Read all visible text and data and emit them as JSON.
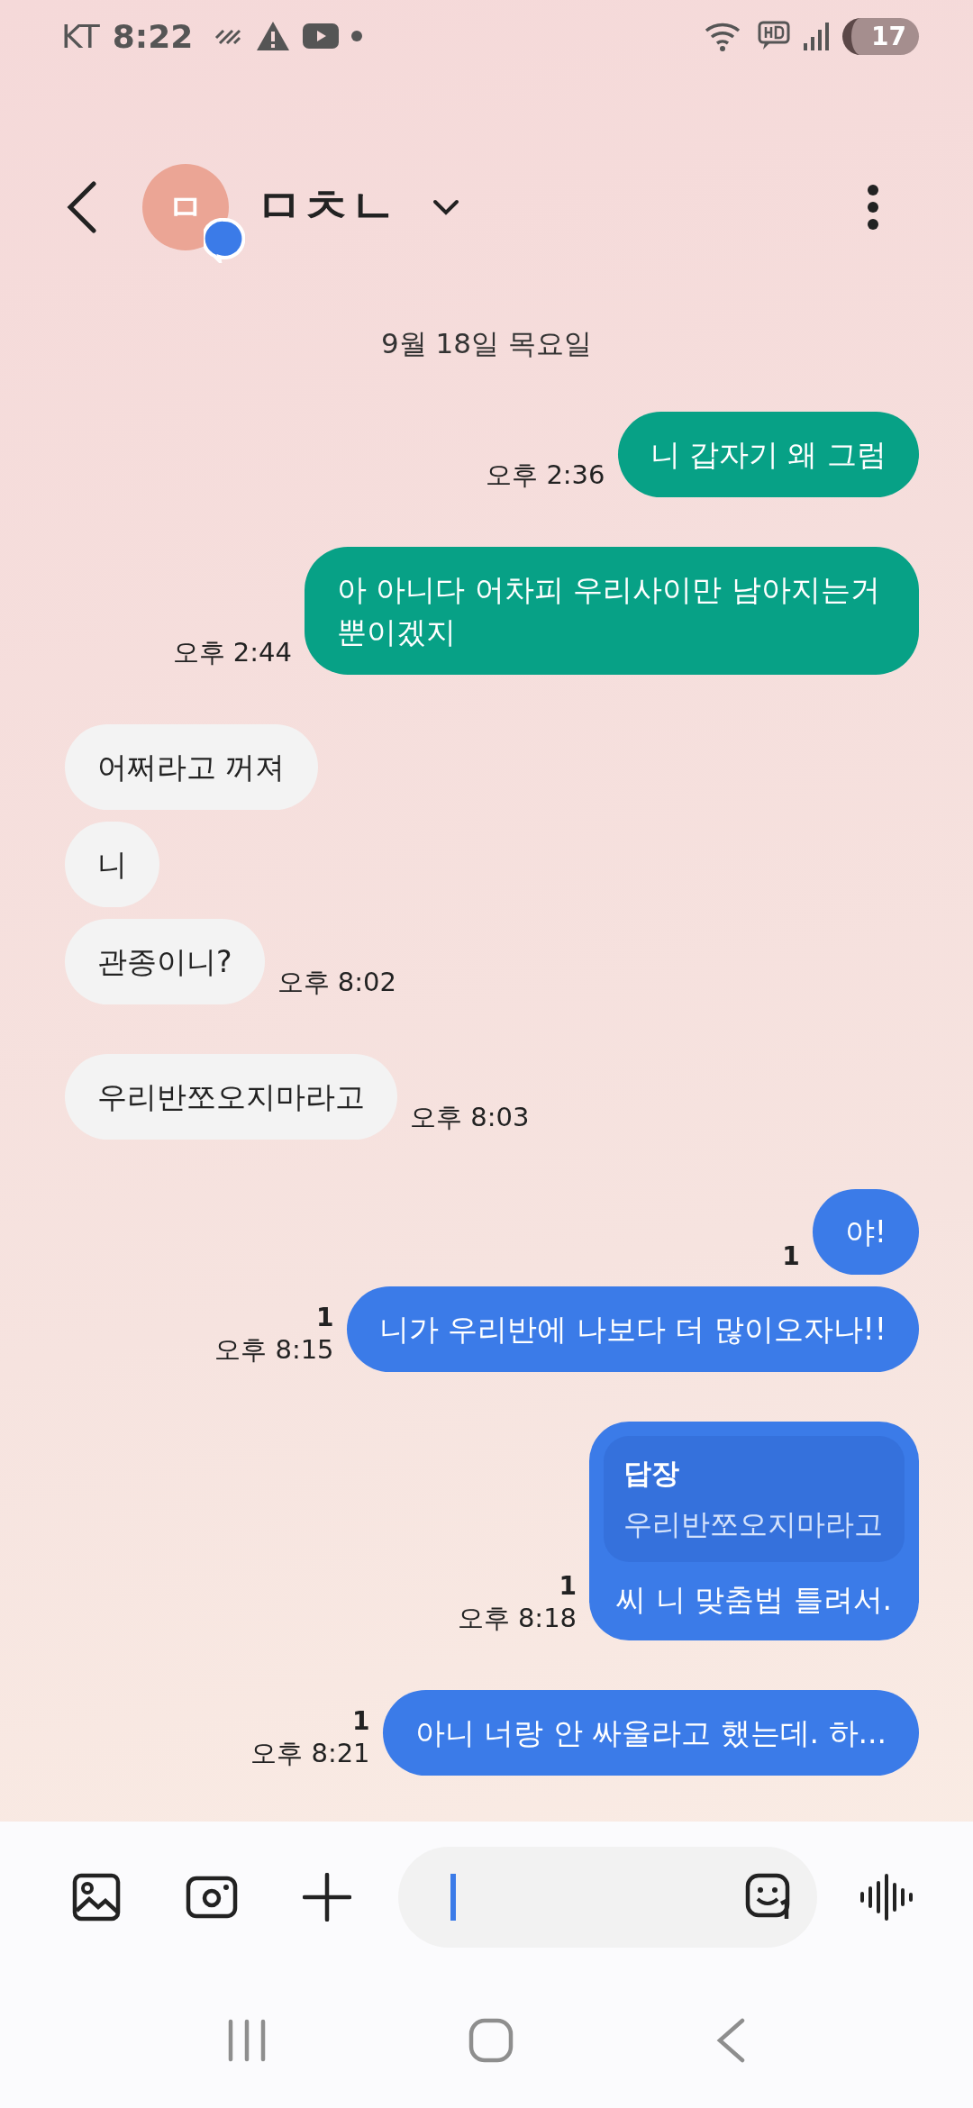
{
  "status_bar": {
    "carrier": "KT",
    "time": "8:22",
    "battery": "17"
  },
  "header": {
    "avatar_letter": "ㅁ",
    "contact_name": "ㅁㅊㄴ"
  },
  "date_divider": "9월 18일 목요일",
  "messages": [
    {
      "kind": "sent_sms",
      "text": "니 갑자기 왜 그럼",
      "time": "오후 2:36"
    },
    {
      "kind": "sent_sms",
      "text": "아 아니다 어차피 우리사이만 남아지는거 뿐이겠지",
      "time": "오후 2:44"
    },
    {
      "kind": "received",
      "text": "어쩌라고 꺼져"
    },
    {
      "kind": "received",
      "text": "니"
    },
    {
      "kind": "received",
      "text": "관종이니?",
      "time": "오후 8:02"
    },
    {
      "kind": "received",
      "text": "우리반쪼오지마라고",
      "time": "오후 8:03"
    },
    {
      "kind": "sent_chat",
      "text": "야!",
      "unread": "1"
    },
    {
      "kind": "sent_chat",
      "text": "니가 우리반에 나보다 더 많이오자나!!",
      "unread": "1",
      "time": "오후 8:15"
    },
    {
      "kind": "sent_chat",
      "reply": {
        "label": "답장",
        "text": "우리반쪼오지마라고"
      },
      "text": "씨 니 맞춤법 틀려서.",
      "unread": "1",
      "time": "오후 8:18"
    },
    {
      "kind": "sent_chat",
      "text": "아니 너랑 안 싸울라고 했는데. 하...",
      "unread": "1",
      "time": "오후 8:21"
    }
  ]
}
